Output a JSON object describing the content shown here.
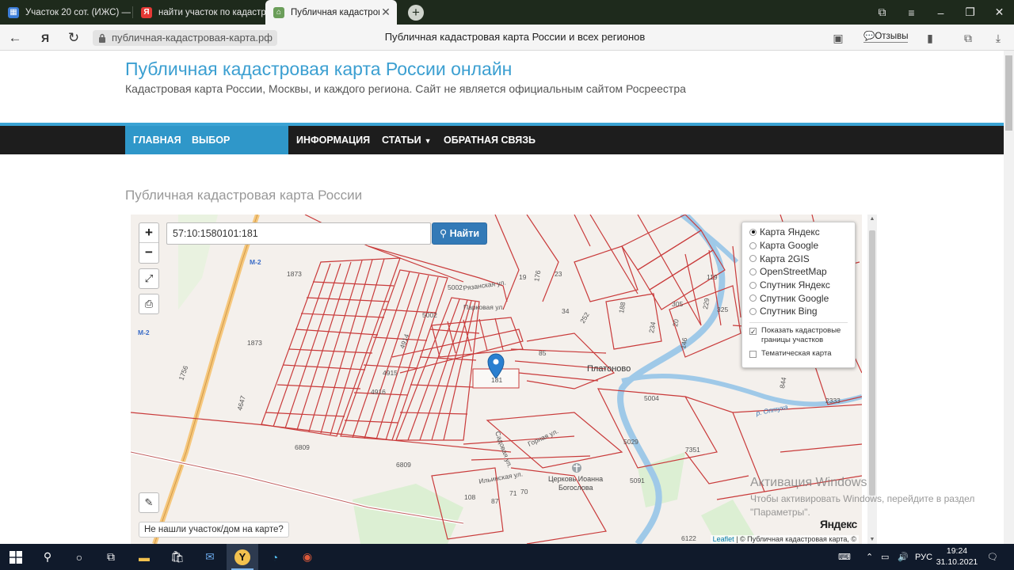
{
  "browser": {
    "tabs": [
      {
        "title": "Участок 20 сот. (ИЖС) — |",
        "active": false
      },
      {
        "title": "найти участок по кадастр",
        "active": false
      },
      {
        "title": "Публичная кадастрова",
        "active": true
      }
    ],
    "url": "публичная-кадастровая-карта.рф",
    "page_title": "Публичная кадастровая карта России и всех регионов",
    "reviews_label": "Отзывы"
  },
  "site": {
    "title": "Публичная кадастровая карта России онлайн",
    "subtitle": "Кадастровая карта России, Москвы, и каждого региона. Сайт не является официальным сайтом Росреестра",
    "menu": [
      {
        "label": "ГЛАВНАЯ"
      },
      {
        "label": "ВЫБОР РЕГИОНА"
      },
      {
        "label": "ИНФОРМАЦИЯ"
      },
      {
        "label": "СТАТЬИ"
      },
      {
        "label": "ОБРАТНАЯ СВЯЗЬ"
      }
    ],
    "section_title": "Публичная кадастровая карта России"
  },
  "map": {
    "search_value": "57:10:1580101:181",
    "find_label": "Найти",
    "layers": [
      {
        "label": "Карта Яндекс",
        "selected": true
      },
      {
        "label": "Карта Google",
        "selected": false
      },
      {
        "label": "Карта 2GIS",
        "selected": false
      },
      {
        "label": "OpenStreetMap",
        "selected": false
      },
      {
        "label": "Спутник Яндекс",
        "selected": false
      },
      {
        "label": "Спутник Google",
        "selected": false
      },
      {
        "label": "Спутник Bing",
        "selected": false
      }
    ],
    "show_borders_label": "Показать кадастровые границы участков",
    "show_borders_checked": true,
    "thematic_label": "Тематическая карта",
    "thematic_checked": false,
    "not_found_label": "Не нашли участок/дом на карте?",
    "attribution_leaflet": "Leaflet",
    "attribution_rest": " | © Публичная кадастровая карта, ©",
    "yandex_logo": "Яндекс",
    "labels": {
      "m2a": "М-2",
      "m2b": "М-2",
      "n1873a": "1873",
      "n1873b": "1873",
      "n1756": "1756",
      "n4647": "4647",
      "n6809a": "6809",
      "n6809b": "6809",
      "n5002a": "5002",
      "n5002b": "5002",
      "n4914": "4914",
      "n4915": "4915",
      "n4916": "4916",
      "n181": "181",
      "n85": "85",
      "n34": "34",
      "n252": "252",
      "n188": "188",
      "n234": "234",
      "n20": "20",
      "n305": "305",
      "n325": "325",
      "n119": "119",
      "n229": "229",
      "n146": "146",
      "n176": "176",
      "n19": "19",
      "n23": "23",
      "n5004": "5004",
      "n5029": "5029",
      "n7351": "7351",
      "n5091": "5091",
      "n2333": "2333",
      "n6122": "6122",
      "n108": "108",
      "n87": "87",
      "n71": "71",
      "n70": "70",
      "n844": "844",
      "village": "Платоново",
      "church": "Церковь Иоанна",
      "church2": "Богослова",
      "river": "р. Оптуха",
      "street1": "Рязанская ул.",
      "street2": "Парковая ул.",
      "street3": "Горная ул.",
      "street4": "Садовая ул.",
      "street5": "Ильинская ул."
    }
  },
  "windows": {
    "activation_title": "Активация Windows",
    "activation_text1": "Чтобы активировать Windows, перейдите в раздел",
    "activation_text2": "\"Параметры\".",
    "lang": "РУС",
    "time": "19:24",
    "date": "31.10.2021"
  }
}
